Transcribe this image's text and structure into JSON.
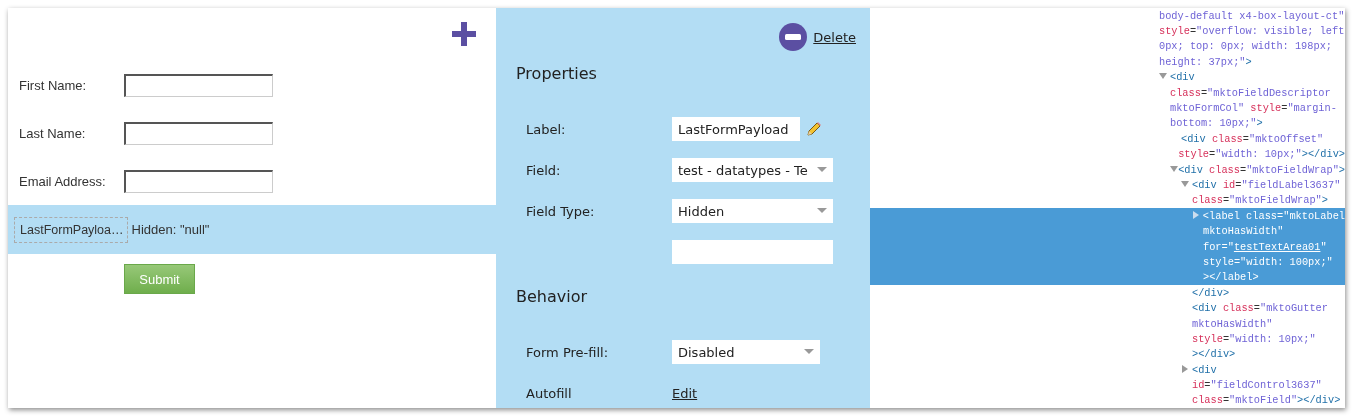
{
  "form": {
    "fields": [
      {
        "label": "First Name:",
        "kind": "text",
        "selected": false
      },
      {
        "label": "Last Name:",
        "kind": "text",
        "selected": false
      },
      {
        "label": "Email Address:",
        "kind": "text",
        "selected": false
      },
      {
        "label": "LastFormPayloa…",
        "kind": "hidden",
        "value": "Hidden: \"null\"",
        "selected": true
      }
    ],
    "submit": "Submit"
  },
  "properties": {
    "delete": "Delete",
    "sections": [
      {
        "title": "Properties",
        "rows": [
          {
            "label": "Label:",
            "kind": "editable_text",
            "value": "LastFormPayload"
          },
          {
            "label": "Field:",
            "kind": "select",
            "value": "test - datatypes - Te"
          },
          {
            "label": "Field Type:",
            "kind": "select",
            "value": "Hidden"
          },
          {
            "kind": "text"
          }
        ]
      },
      {
        "title": "Behavior",
        "rows": [
          {
            "label": "Form Pre-fill:",
            "kind": "select",
            "value": "Disabled"
          },
          {
            "label": "Autofill",
            "kind": "link",
            "value": "Edit"
          }
        ]
      }
    ]
  },
  "dom_tree": [
    {
      "selected": false,
      "lines": [
        [
          {
            "kind": "value",
            "text": "body-default x4-box-layout-ct\""
          }
        ],
        [
          {
            "kind": "attr",
            "text": "style"
          },
          {
            "kind": "punct",
            "text": "="
          },
          {
            "kind": "value",
            "text": "\"overflow: visible; left"
          }
        ],
        [
          {
            "kind": "value",
            "text": "0px; top: 0px; width: 198px;"
          }
        ],
        [
          {
            "kind": "value",
            "text": "height: 37px;\""
          },
          {
            "kind": "tag",
            "text": ">"
          }
        ]
      ],
      "children": [
        {
          "kind": "parent",
          "expanded": true,
          "selected": false,
          "lines": [
            [
              {
                "kind": "tag",
                "text": "<div"
              }
            ],
            [
              {
                "kind": "attr",
                "text": "class"
              },
              {
                "kind": "punct",
                "text": "="
              },
              {
                "kind": "value",
                "text": "\"mktoFieldDescriptor"
              }
            ],
            [
              {
                "kind": "value",
                "text": "mktoFormCol\""
              },
              {
                "kind": "attr",
                "text": " style"
              },
              {
                "kind": "punct",
                "text": "="
              },
              {
                "kind": "value",
                "text": "\"margin-"
              }
            ],
            [
              {
                "kind": "value",
                "text": "bottom: 10px;\""
              },
              {
                "kind": "tag",
                "text": ">"
              }
            ]
          ],
          "children": [
            {
              "kind": "leaf",
              "selected": false,
              "lines": [
                [
                  {
                    "kind": "tag",
                    "text": "<div"
                  },
                  {
                    "kind": "attr",
                    "text": " class"
                  },
                  {
                    "kind": "punct",
                    "text": "="
                  },
                  {
                    "kind": "value",
                    "text": "\"mktoOffset\""
                  }
                ],
                [
                  {
                    "kind": "attr",
                    "text": "style"
                  },
                  {
                    "kind": "punct",
                    "text": "="
                  },
                  {
                    "kind": "value",
                    "text": "\"width: 10px;\""
                  },
                  {
                    "kind": "tag",
                    "text": "></div>"
                  }
                ]
              ]
            },
            {
              "kind": "parent",
              "expanded": true,
              "selected": false,
              "lines": [
                [
                  {
                    "kind": "tag",
                    "text": "<div"
                  },
                  {
                    "kind": "attr",
                    "text": " class"
                  },
                  {
                    "kind": "punct",
                    "text": "="
                  },
                  {
                    "kind": "value",
                    "text": "\"mktoFieldWrap\""
                  },
                  {
                    "kind": "tag",
                    "text": ">"
                  }
                ]
              ],
              "children": [
                {
                  "kind": "parent",
                  "expanded": true,
                  "selected": false,
                  "lines": [
                    [
                      {
                        "kind": "tag",
                        "text": "<div"
                      },
                      {
                        "kind": "attr",
                        "text": " id"
                      },
                      {
                        "kind": "punct",
                        "text": "="
                      },
                      {
                        "kind": "value",
                        "text": "\"fieldLabel3637\""
                      }
                    ],
                    [
                      {
                        "kind": "attr",
                        "text": "class"
                      },
                      {
                        "kind": "punct",
                        "text": "="
                      },
                      {
                        "kind": "value",
                        "text": "\"mktoFieldWrap\""
                      },
                      {
                        "kind": "tag",
                        "text": ">"
                      }
                    ]
                  ],
                  "children": [
                    {
                      "kind": "parent",
                      "expanded": false,
                      "selected": true,
                      "lines": [
                        [
                          {
                            "kind": "tag",
                            "text": "<label"
                          },
                          {
                            "kind": "attr",
                            "text": " class"
                          },
                          {
                            "kind": "punct",
                            "text": "="
                          },
                          {
                            "kind": "value",
                            "text": "\"mktoLabel"
                          }
                        ],
                        [
                          {
                            "kind": "value",
                            "text": "mktoHasWidth\""
                          }
                        ],
                        [
                          {
                            "kind": "attr",
                            "text": "for"
                          },
                          {
                            "kind": "punct",
                            "text": "=\""
                          },
                          {
                            "kind": "link",
                            "text": "testTextArea01"
                          },
                          {
                            "kind": "punct",
                            "text": "\""
                          }
                        ],
                        [
                          {
                            "kind": "attr",
                            "text": "style"
                          },
                          {
                            "kind": "punct",
                            "text": "="
                          },
                          {
                            "kind": "value",
                            "text": "\"width: 100px;\""
                          }
                        ],
                        [
                          {
                            "kind": "tag",
                            "text": "></label>"
                          }
                        ]
                      ]
                    }
                  ],
                  "closing": [
                    [
                      {
                        "kind": "tag",
                        "text": "</div>"
                      }
                    ]
                  ]
                },
                {
                  "kind": "leaf",
                  "selected": false,
                  "lines": [
                    [
                      {
                        "kind": "tag",
                        "text": "<div"
                      },
                      {
                        "kind": "attr",
                        "text": " class"
                      },
                      {
                        "kind": "punct",
                        "text": "="
                      },
                      {
                        "kind": "value",
                        "text": "\"mktoGutter"
                      }
                    ],
                    [
                      {
                        "kind": "value",
                        "text": "mktoHasWidth\""
                      }
                    ],
                    [
                      {
                        "kind": "attr",
                        "text": "style"
                      },
                      {
                        "kind": "punct",
                        "text": "="
                      },
                      {
                        "kind": "value",
                        "text": "\"width: 10px;\""
                      }
                    ],
                    [
                      {
                        "kind": "tag",
                        "text": "></div>"
                      }
                    ]
                  ]
                },
                {
                  "kind": "parent",
                  "expanded": false,
                  "selected": false,
                  "lines": [
                    [
                      {
                        "kind": "tag",
                        "text": "<div"
                      }
                    ],
                    [
                      {
                        "kind": "attr",
                        "text": "id"
                      },
                      {
                        "kind": "punct",
                        "text": "="
                      },
                      {
                        "kind": "value",
                        "text": "\"fieldControl3637\""
                      }
                    ],
                    [
                      {
                        "kind": "attr",
                        "text": "class"
                      },
                      {
                        "kind": "punct",
                        "text": "="
                      },
                      {
                        "kind": "value",
                        "text": "\"mktoField\""
                      },
                      {
                        "kind": "tag",
                        "text": "></div>"
                      }
                    ]
                  ]
                }
              ]
            }
          ]
        }
      ]
    }
  ]
}
